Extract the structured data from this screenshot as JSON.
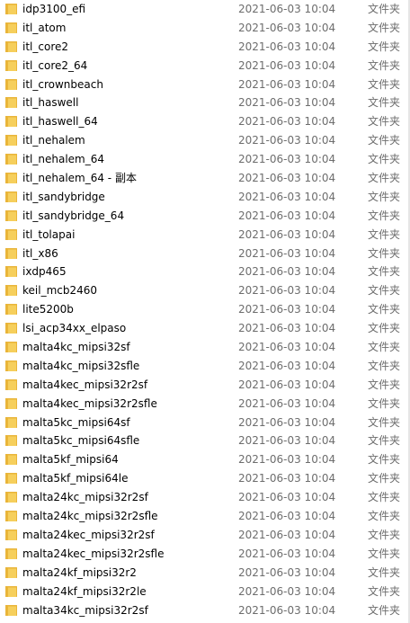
{
  "colors": {
    "folder_fill": "#f6cf5c",
    "folder_back": "#e9b53a",
    "secondary_text": "#6d6d6d"
  },
  "rows": [
    {
      "name": "idp3100_efi",
      "date": "2021-06-03 10:04",
      "type": "文件夹"
    },
    {
      "name": "itl_atom",
      "date": "2021-06-03 10:04",
      "type": "文件夹"
    },
    {
      "name": "itl_core2",
      "date": "2021-06-03 10:04",
      "type": "文件夹"
    },
    {
      "name": "itl_core2_64",
      "date": "2021-06-03 10:04",
      "type": "文件夹"
    },
    {
      "name": "itl_crownbeach",
      "date": "2021-06-03 10:04",
      "type": "文件夹"
    },
    {
      "name": "itl_haswell",
      "date": "2021-06-03 10:04",
      "type": "文件夹"
    },
    {
      "name": "itl_haswell_64",
      "date": "2021-06-03 10:04",
      "type": "文件夹"
    },
    {
      "name": "itl_nehalem",
      "date": "2021-06-03 10:04",
      "type": "文件夹"
    },
    {
      "name": "itl_nehalem_64",
      "date": "2021-06-03 10:04",
      "type": "文件夹"
    },
    {
      "name": "itl_nehalem_64 - 副本",
      "date": "2021-06-03 10:04",
      "type": "文件夹"
    },
    {
      "name": "itl_sandybridge",
      "date": "2021-06-03 10:04",
      "type": "文件夹"
    },
    {
      "name": "itl_sandybridge_64",
      "date": "2021-06-03 10:04",
      "type": "文件夹"
    },
    {
      "name": "itl_tolapai",
      "date": "2021-06-03 10:04",
      "type": "文件夹"
    },
    {
      "name": "itl_x86",
      "date": "2021-06-03 10:04",
      "type": "文件夹"
    },
    {
      "name": "ixdp465",
      "date": "2021-06-03 10:04",
      "type": "文件夹"
    },
    {
      "name": "keil_mcb2460",
      "date": "2021-06-03 10:04",
      "type": "文件夹"
    },
    {
      "name": "lite5200b",
      "date": "2021-06-03 10:04",
      "type": "文件夹"
    },
    {
      "name": "lsi_acp34xx_elpaso",
      "date": "2021-06-03 10:04",
      "type": "文件夹"
    },
    {
      "name": "malta4kc_mipsi32sf",
      "date": "2021-06-03 10:04",
      "type": "文件夹"
    },
    {
      "name": "malta4kc_mipsi32sfle",
      "date": "2021-06-03 10:04",
      "type": "文件夹"
    },
    {
      "name": "malta4kec_mipsi32r2sf",
      "date": "2021-06-03 10:04",
      "type": "文件夹"
    },
    {
      "name": "malta4kec_mipsi32r2sfle",
      "date": "2021-06-03 10:04",
      "type": "文件夹"
    },
    {
      "name": "malta5kc_mipsi64sf",
      "date": "2021-06-03 10:04",
      "type": "文件夹"
    },
    {
      "name": "malta5kc_mipsi64sfle",
      "date": "2021-06-03 10:04",
      "type": "文件夹"
    },
    {
      "name": "malta5kf_mipsi64",
      "date": "2021-06-03 10:04",
      "type": "文件夹"
    },
    {
      "name": "malta5kf_mipsi64le",
      "date": "2021-06-03 10:04",
      "type": "文件夹"
    },
    {
      "name": "malta24kc_mipsi32r2sf",
      "date": "2021-06-03 10:04",
      "type": "文件夹"
    },
    {
      "name": "malta24kc_mipsi32r2sfle",
      "date": "2021-06-03 10:04",
      "type": "文件夹"
    },
    {
      "name": "malta24kec_mipsi32r2sf",
      "date": "2021-06-03 10:04",
      "type": "文件夹"
    },
    {
      "name": "malta24kec_mipsi32r2sfle",
      "date": "2021-06-03 10:04",
      "type": "文件夹"
    },
    {
      "name": "malta24kf_mipsi32r2",
      "date": "2021-06-03 10:04",
      "type": "文件夹"
    },
    {
      "name": "malta24kf_mipsi32r2le",
      "date": "2021-06-03 10:04",
      "type": "文件夹"
    },
    {
      "name": "malta34kc_mipsi32r2sf",
      "date": "2021-06-03 10:04",
      "type": "文件夹"
    }
  ]
}
